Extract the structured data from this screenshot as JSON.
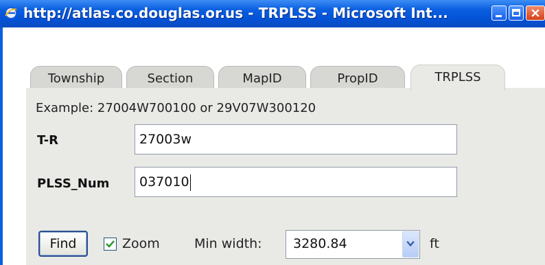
{
  "window": {
    "title": "http://atlas.co.douglas.or.us - TRPLSS - Microsoft Int...",
    "controls": {
      "minimize": "minimize-icon",
      "maximize": "maximize-icon",
      "close": "close-icon"
    }
  },
  "tabs": [
    {
      "label": "Township",
      "active": false
    },
    {
      "label": "Section",
      "active": false
    },
    {
      "label": "MapID",
      "active": false
    },
    {
      "label": "PropID",
      "active": false
    },
    {
      "label": "TRPLSS",
      "active": true
    }
  ],
  "form": {
    "example": "Example: 27004W700100 or 29V07W300120",
    "tr_label": "T-R",
    "tr_value": "27003w",
    "plss_label": "PLSS_Num",
    "plss_value": "037010",
    "find_label": "Find",
    "zoom_checked": true,
    "zoom_label": "Zoom",
    "min_width_label": "Min width:",
    "min_width_value": "3280.84",
    "unit": "ft"
  },
  "colors": {
    "titlebar": "#0452d6",
    "panel": "#e9e9e6",
    "check": "#2b9a2b"
  }
}
